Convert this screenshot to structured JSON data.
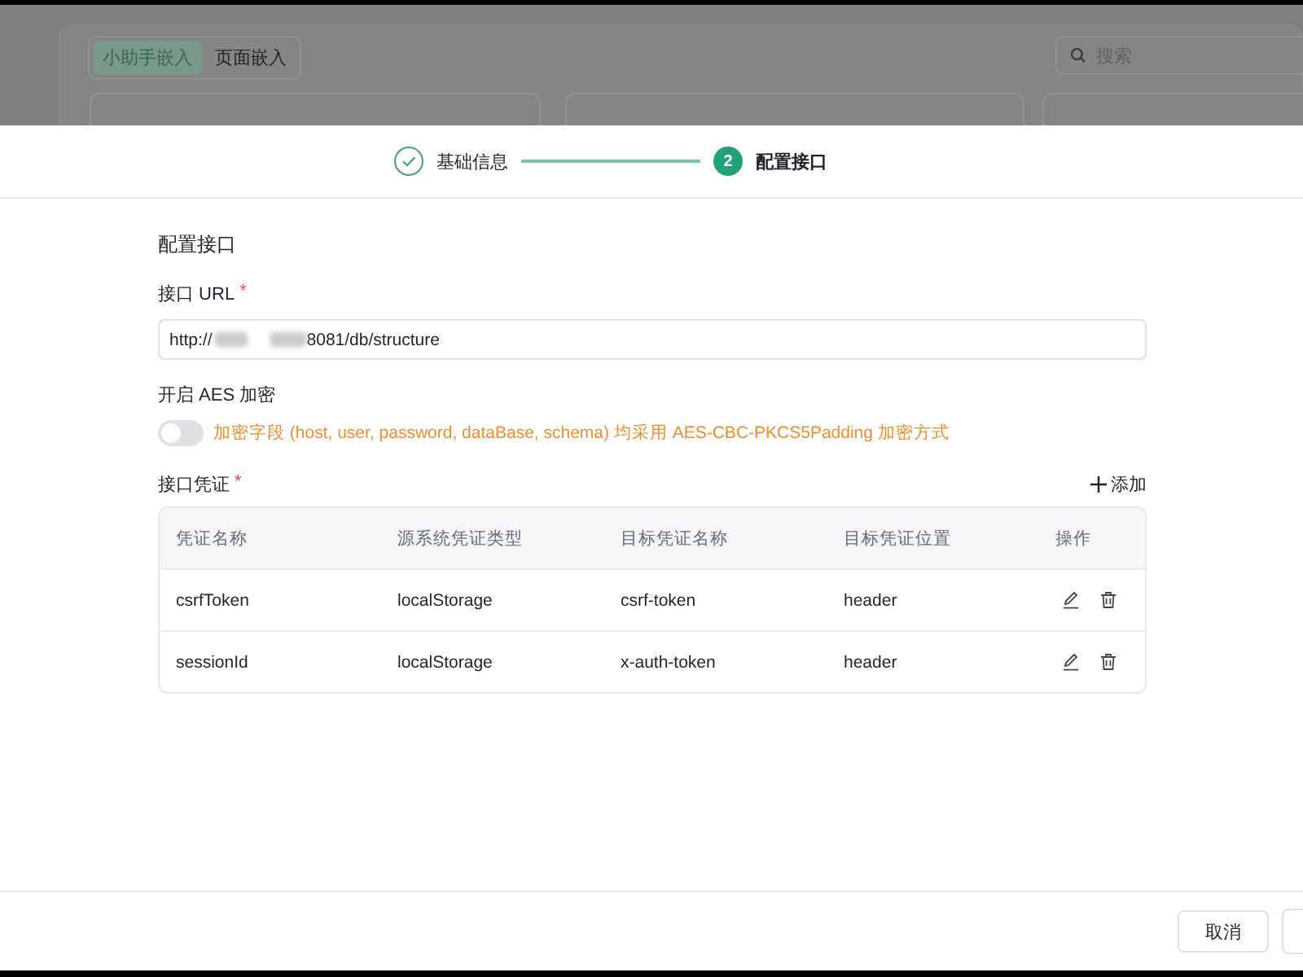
{
  "background": {
    "tabs": [
      {
        "label": "小助手嵌入",
        "selected": true
      },
      {
        "label": "页面嵌入",
        "selected": false
      }
    ],
    "search": {
      "placeholder": "搜索"
    }
  },
  "steps": [
    {
      "done": true,
      "selected": false,
      "label": "基础信息"
    },
    {
      "done": false,
      "selected": true,
      "number": "2",
      "label": "配置接口"
    }
  ],
  "section_title": "配置接口",
  "url_field": {
    "label": "接口 URL",
    "required_mark": "*",
    "value_start": "http://",
    "value_end": "8081/db/structure"
  },
  "aes": {
    "label": "开启 AES 加密",
    "on": false,
    "hint": "加密字段 (host, user, password, dataBase, schema) 均采用 AES-CBC-PKCS5Padding 加密方式"
  },
  "credentials": {
    "label": "接口凭证",
    "required_mark": "*",
    "add_button": "添加",
    "columns": [
      "凭证名称",
      "源系统凭证类型",
      "目标凭证名称",
      "目标凭证位置",
      "操作"
    ],
    "rows": [
      [
        "csrfToken",
        "localStorage",
        "csrf-token",
        "header"
      ],
      [
        "sessionId",
        "localStorage",
        "x-auth-token",
        "header"
      ]
    ]
  },
  "footer": {
    "cancel": "取消"
  }
}
